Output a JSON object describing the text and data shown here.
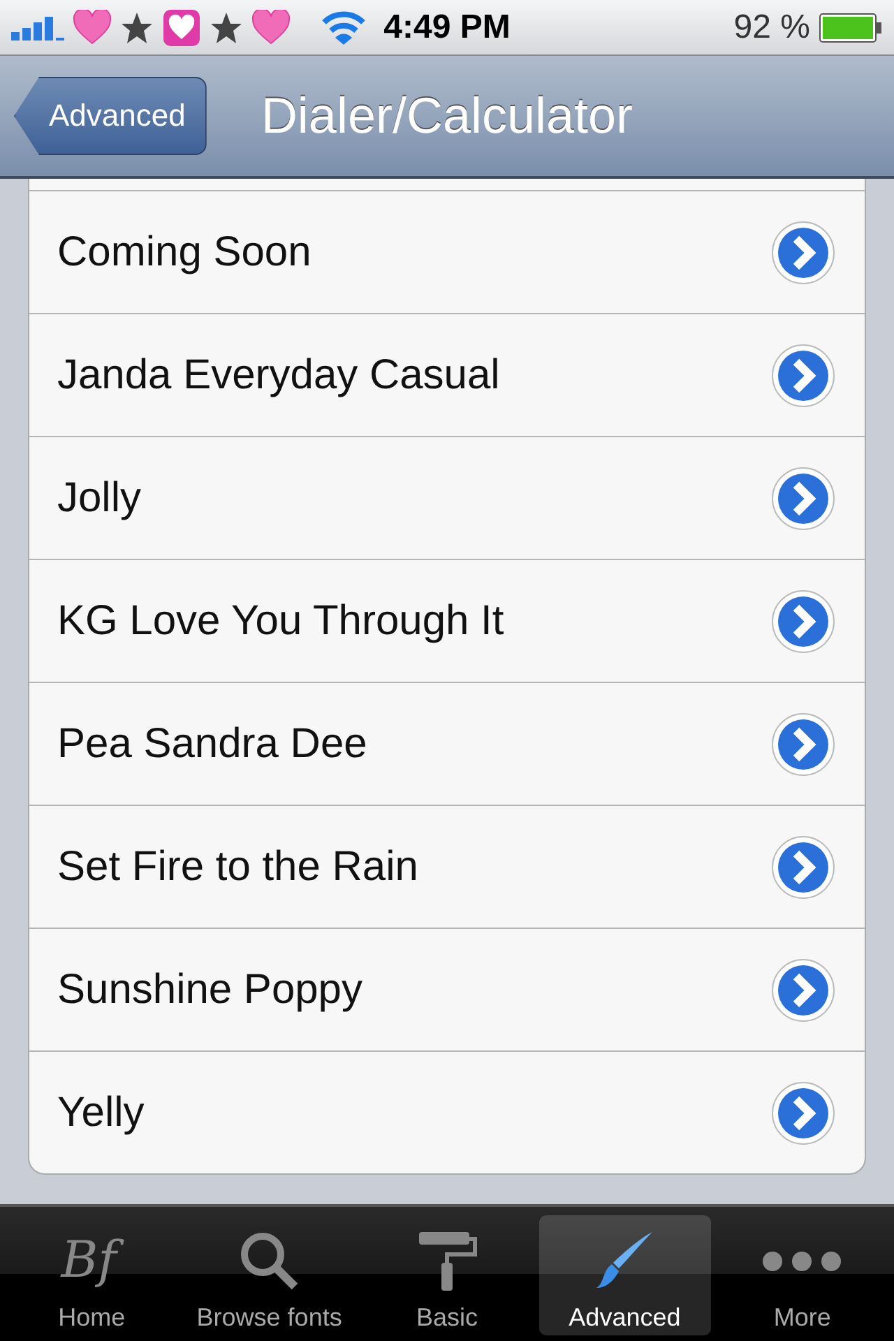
{
  "status_bar": {
    "time": "4:49 PM",
    "battery": "92 %"
  },
  "nav_bar": {
    "back": "Advanced",
    "title": "Dialer/Calculator"
  },
  "list": [
    {
      "label": "Coming Soon"
    },
    {
      "label": "Janda Everyday Casual"
    },
    {
      "label": "Jolly"
    },
    {
      "label": "KG Love You Through It"
    },
    {
      "label": "Pea Sandra Dee"
    },
    {
      "label": "Set Fire to the Rain"
    },
    {
      "label": "Sunshine Poppy"
    },
    {
      "label": "Yelly"
    }
  ],
  "tab_bar": [
    {
      "label": "Home",
      "kind": "logo",
      "logo_text": "Bf",
      "selected": false
    },
    {
      "label": "Browse fonts",
      "kind": "search",
      "selected": false
    },
    {
      "label": "Basic",
      "kind": "roller",
      "selected": false
    },
    {
      "label": "Advanced",
      "kind": "brush",
      "selected": true
    },
    {
      "label": "More",
      "kind": "dots",
      "selected": false
    }
  ]
}
